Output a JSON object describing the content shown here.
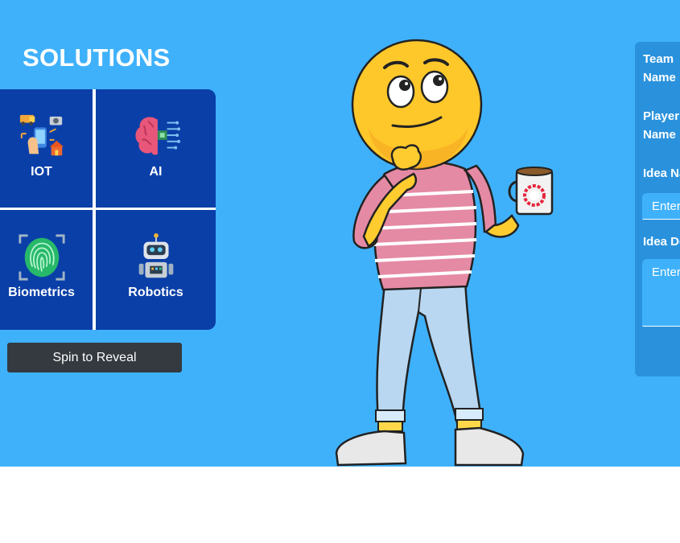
{
  "solutions": {
    "title": "SOLUTIONS",
    "items": [
      {
        "label": "IOT",
        "icon": "iot-devices-icon"
      },
      {
        "label": "AI",
        "icon": "brain-chip-icon"
      },
      {
        "label": "Biometrics",
        "icon": "fingerprint-icon"
      },
      {
        "label": "Robotics",
        "icon": "robot-icon"
      }
    ]
  },
  "spin_button": {
    "label": "Spin to Reveal"
  },
  "form": {
    "team_label_1": "Team",
    "team_label_2": "Name",
    "player_label_1": "Player",
    "player_label_2": "Name",
    "idea_name_label": "Idea Name",
    "idea_name_placeholder": "Enter",
    "idea_desc_label": "Idea Description",
    "idea_desc_placeholder": "Enter"
  },
  "colors": {
    "background": "#3fb1fb",
    "grid": "#0a3fa8",
    "button": "#343a40",
    "form_panel": "#2a92dd"
  }
}
